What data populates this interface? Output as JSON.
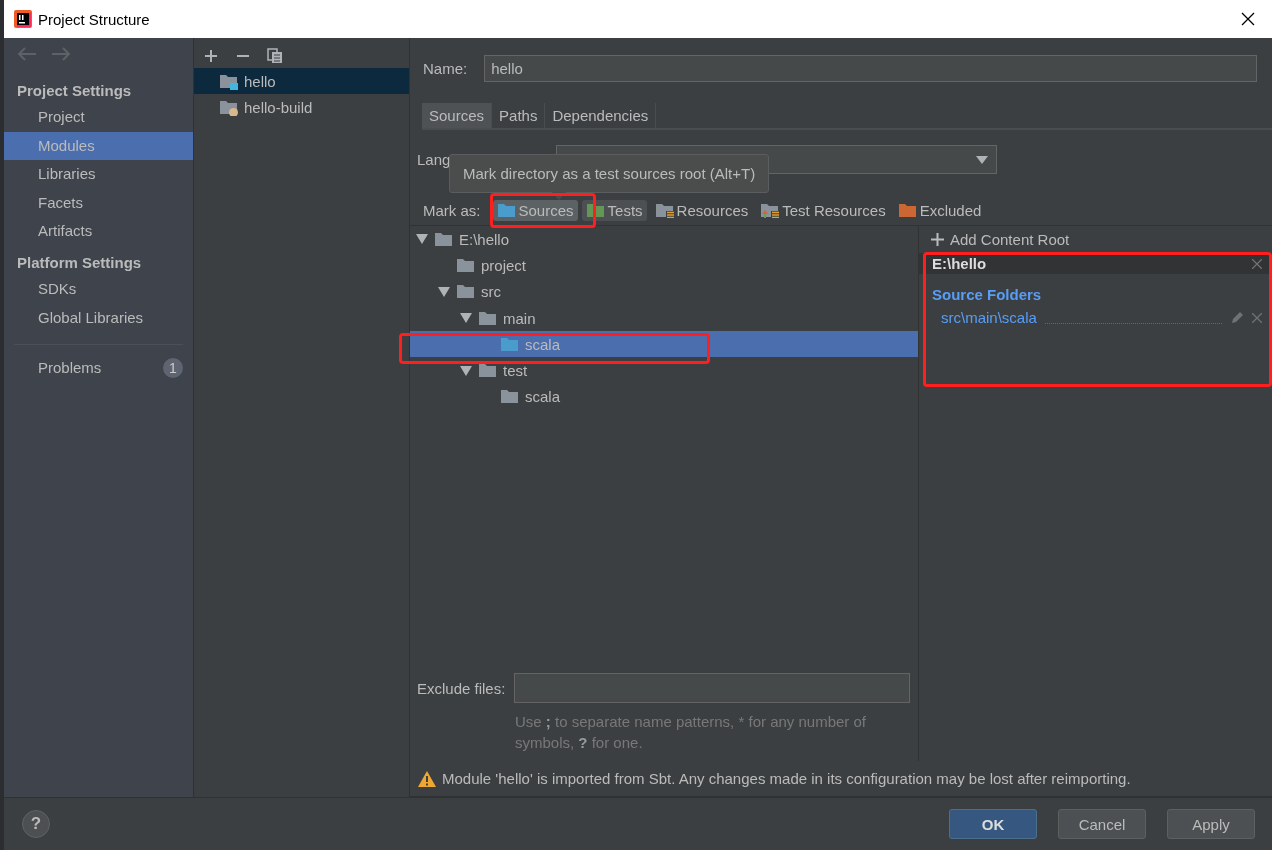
{
  "window": {
    "title": "Project Structure"
  },
  "sidebar": {
    "sections": [
      {
        "heading": "Project Settings",
        "items": [
          {
            "label": "Project",
            "selected": false
          },
          {
            "label": "Modules",
            "selected": true
          },
          {
            "label": "Libraries",
            "selected": false
          },
          {
            "label": "Facets",
            "selected": false
          },
          {
            "label": "Artifacts",
            "selected": false
          }
        ]
      },
      {
        "heading": "Platform Settings",
        "items": [
          {
            "label": "SDKs",
            "selected": false
          },
          {
            "label": "Global Libraries",
            "selected": false
          }
        ]
      }
    ],
    "problems": {
      "label": "Problems",
      "count": "1"
    }
  },
  "modules": [
    {
      "label": "hello",
      "kind": "module",
      "selected": true
    },
    {
      "label": "hello-build",
      "kind": "build",
      "selected": false
    }
  ],
  "name_field": {
    "label": "Name:",
    "value": "hello"
  },
  "tabs": [
    {
      "label": "Sources",
      "selected": true
    },
    {
      "label": "Paths",
      "selected": false
    },
    {
      "label": "Dependencies",
      "selected": false
    }
  ],
  "language_level": {
    "label": "Lang"
  },
  "tooltip": {
    "text": "Mark directory as a test sources root (Alt+T)"
  },
  "mark_as": {
    "label": "Mark as:",
    "buttons": [
      {
        "label": "Sources",
        "kind": "sources",
        "selected": true,
        "hovered": false
      },
      {
        "label": "Tests",
        "kind": "tests",
        "selected": false,
        "hovered": true
      },
      {
        "label": "Resources",
        "kind": "resources",
        "selected": false,
        "hovered": false
      },
      {
        "label": "Test Resources",
        "kind": "test-resources",
        "selected": false,
        "hovered": false
      },
      {
        "label": "Excluded",
        "kind": "excluded",
        "selected": false,
        "hovered": false
      }
    ]
  },
  "tree": [
    {
      "label": "E:\\hello",
      "kind": "folder",
      "expanded": true,
      "selected": false,
      "children": [
        {
          "label": "project",
          "kind": "folder",
          "selected": false
        },
        {
          "label": "src",
          "kind": "folder",
          "expanded": true,
          "selected": false,
          "children": [
            {
              "label": "main",
              "kind": "folder",
              "expanded": true,
              "selected": false,
              "children": [
                {
                  "label": "scala",
                  "kind": "source",
                  "selected": true
                }
              ]
            },
            {
              "label": "test",
              "kind": "folder",
              "expanded": true,
              "selected": false,
              "children": [
                {
                  "label": "scala",
                  "kind": "folder",
                  "selected": false
                }
              ]
            }
          ]
        }
      ]
    }
  ],
  "content_root": {
    "add_label": "Add Content Root",
    "path": "E:\\hello",
    "heading": "Source Folders",
    "folders": [
      "src\\main\\scala"
    ]
  },
  "exclude_files": {
    "label": "Exclude files:",
    "hint": "Use **;** to separate name patterns, * for any number of symbols, **?** for one."
  },
  "warning": "Module 'hello' is imported from Sbt. Any changes made in its configuration may be lost after reimporting.",
  "help_button": {
    "label": "?"
  },
  "buttons": [
    {
      "label": "OK",
      "kind": "default"
    },
    {
      "label": "Cancel",
      "kind": "normal"
    },
    {
      "label": "Apply",
      "kind": "normal"
    }
  ]
}
